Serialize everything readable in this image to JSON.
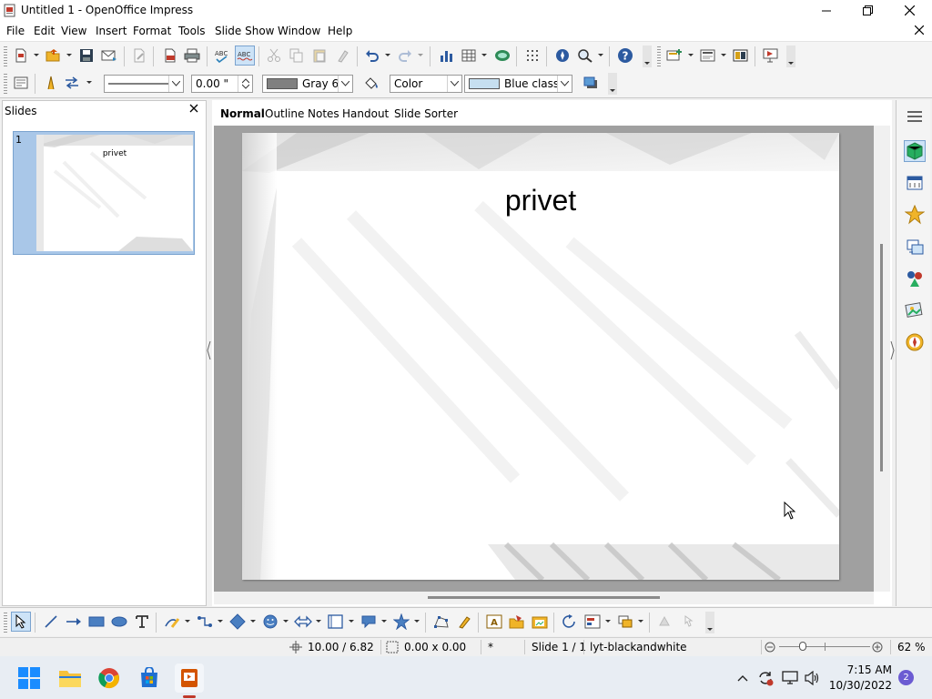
{
  "window": {
    "title": "Untitled 1 - OpenOffice Impress"
  },
  "menubar": {
    "items": [
      {
        "key": "file",
        "label": "File"
      },
      {
        "key": "edit",
        "label": "Edit"
      },
      {
        "key": "view",
        "label": "View"
      },
      {
        "key": "insert",
        "label": "Insert"
      },
      {
        "key": "format",
        "label": "Format"
      },
      {
        "key": "tools",
        "label": "Tools"
      },
      {
        "key": "slideshow",
        "label": "Slide Show"
      },
      {
        "key": "window",
        "label": "Window"
      },
      {
        "key": "help",
        "label": "Help"
      }
    ]
  },
  "line_toolbar": {
    "line_width": "0.00 \"",
    "line_color": "Gray 6",
    "line_color_hex": "#808080",
    "area_style": "Color",
    "area_color": "Blue classic",
    "area_color_hex": "#c6dff0"
  },
  "slides_pane": {
    "title": "Slides",
    "slides": [
      {
        "number": "1",
        "title": "privet"
      }
    ]
  },
  "view_tabs": [
    {
      "key": "normal",
      "label": "Normal",
      "active": true
    },
    {
      "key": "outline",
      "label": "Outline",
      "active": false
    },
    {
      "key": "notes",
      "label": "Notes",
      "active": false
    },
    {
      "key": "handout",
      "label": "Handout",
      "active": false
    },
    {
      "key": "sorter",
      "label": "Slide Sorter",
      "active": false
    }
  ],
  "slide": {
    "title": "privet"
  },
  "statusbar": {
    "position": "10.00 / 6.82",
    "size": "0.00 x 0.00",
    "modified": "*",
    "slide_indicator": "Slide 1 / 1",
    "layout_name": "lyt-blackandwhite",
    "zoom": "62 %",
    "zoom_level": 0.62
  },
  "taskbar": {
    "time": "7:15 AM",
    "date": "10/30/2022",
    "notification_count": "2"
  }
}
